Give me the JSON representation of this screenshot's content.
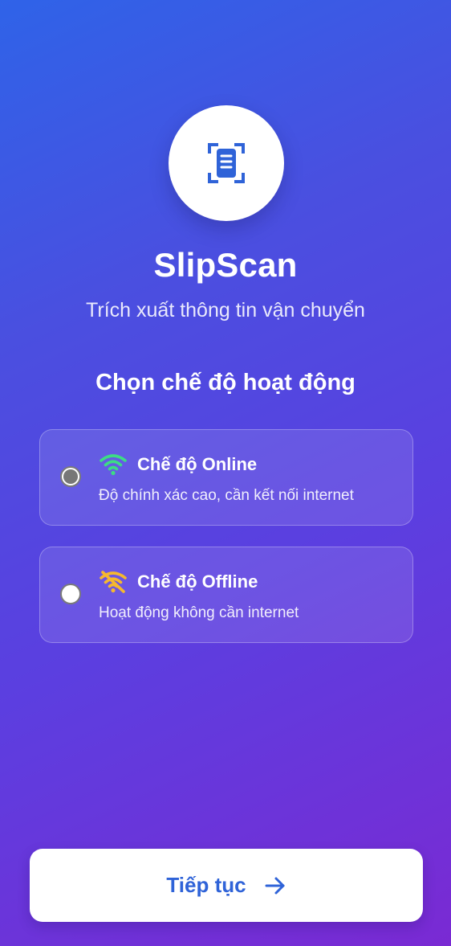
{
  "app": {
    "title": "SlipScan",
    "subtitle": "Trích xuất thông tin vận chuyển",
    "logo_icon": "document-scan-icon"
  },
  "mode_selection": {
    "heading": "Chọn chế độ hoạt động",
    "options": [
      {
        "label": "Chế độ Online",
        "description": "Độ chính xác cao, cần kết nối internet",
        "icon": "wifi-icon",
        "icon_color": "#3ddc84",
        "selected": true
      },
      {
        "label": "Chế độ Offline",
        "description": "Hoạt động không cần internet",
        "icon": "wifi-off-icon",
        "icon_color": "#f5b82e",
        "selected": false
      }
    ]
  },
  "actions": {
    "continue_label": "Tiếp tục",
    "continue_icon": "arrow-right-icon"
  },
  "colors": {
    "accent": "#2f63d8",
    "background_start": "#2f63e8",
    "background_end": "#7a2ad3"
  }
}
